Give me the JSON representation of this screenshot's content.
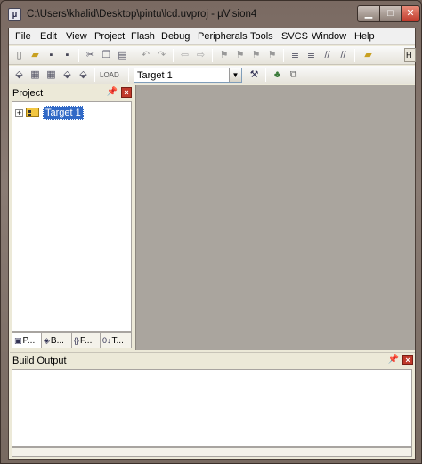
{
  "window": {
    "title": "C:\\Users\\khalid\\Desktop\\pintu\\lcd.uvproj - µVision4",
    "minimize_glyph": "▁",
    "maximize_glyph": "□",
    "close_glyph": "✕"
  },
  "menu": [
    "File",
    "Edit",
    "View",
    "Project",
    "Flash",
    "Debug",
    "Peripherals",
    "Tools",
    "SVCS",
    "Window",
    "Help"
  ],
  "toolbar2": {
    "target_select_value": "Target 1",
    "hs_tab_label": "H"
  },
  "project_panel": {
    "title": "Project",
    "tree_root_label": "Target 1",
    "tabs": [
      {
        "icon": "▣",
        "label": "P..."
      },
      {
        "icon": "◈",
        "label": "B..."
      },
      {
        "icon": "{}",
        "label": "F..."
      },
      {
        "icon": "0↓",
        "label": "T..."
      }
    ]
  },
  "build_output": {
    "title": "Build Output"
  },
  "colors": {
    "selection": "#3169c6",
    "editor_background": "#aaa59e",
    "close_red": "#c0392b"
  }
}
